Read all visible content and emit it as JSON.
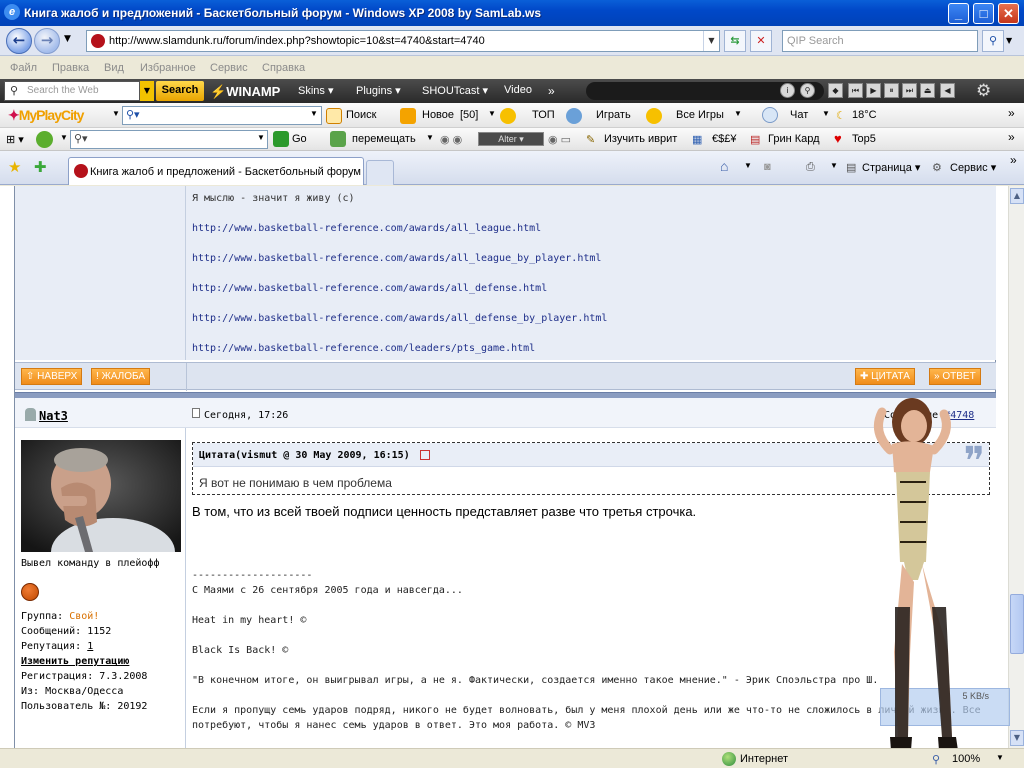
{
  "window": {
    "title": "Книга жалоб и предложений - Баскетбольный форум - Windows XP 2008 by SamLab.ws"
  },
  "address": {
    "url": "http://www.slamdunk.ru/forum/index.php?showtopic=10&st=4740&start=4740",
    "search_placeholder": "QIP Search"
  },
  "menu": [
    "Файл",
    "Правка",
    "Вид",
    "Избранное",
    "Сервис",
    "Справка"
  ],
  "winamp": {
    "search_placeholder": "Search the Web",
    "search_button": "Search",
    "logo": "WINAMP",
    "menus": [
      "Skins",
      "Plugins",
      "SHOUTcast",
      "Video"
    ]
  },
  "mailru": {
    "logo": "MyPlayCity",
    "search": "Поиск",
    "new": "Новое",
    "new_count": "[50]",
    "top": "ТОП",
    "play": "Играть",
    "all_games": "Все Игры",
    "chat": "Чат",
    "weather": "18°C"
  },
  "bar3": {
    "go": "Go",
    "move": "перемещать",
    "player": "Alter",
    "learn": "Изучить иврит",
    "currency": "€$£¥",
    "green_card": "Грин Кард",
    "top5": "Top5"
  },
  "tabs": {
    "active": "Книга жалоб и предложений - Баскетбольный форум",
    "page": "Страница",
    "tools": "Сервис"
  },
  "prev_post": {
    "sig_lines": [
      "Я мыслю - значит я живу (с)",
      "http://www.basketball-reference.com/awards/all_league.html",
      "http://www.basketball-reference.com/awards/all_league_by_player.html",
      "http://www.basketball-reference.com/awards/all_defense.html",
      "http://www.basketball-reference.com/awards/all_defense_by_player.html",
      "http://www.basketball-reference.com/leaders/pts_game.html"
    ],
    "btn_top": "НАВЕРХ",
    "btn_report": "ЖАЛОБА",
    "btn_quote": "ЦИТАТА",
    "btn_reply": "ОТВЕТ"
  },
  "post": {
    "username": "Nat3",
    "date": "Сегодня, 17:26",
    "msg_label": "Сообщение",
    "msg_no": "#4748",
    "quote_header": "Цитата(vismut @ 30 May 2009, 16:15)",
    "quote_text": "Я вот не понимаю в чем проблема",
    "body": "В том, что из всей твоей подписи ценность представляет разве что третья строчка.",
    "sig_lines": [
      "--------------------",
      "С Маями с 26 сентября 2005 года и навсегда...",
      "Heat in my heart! ©",
      "Black Is Back! ©",
      "\"В конечном итоге, он выигрывал игры, а не я. Фактически, создается именно такое мнение.\" - Эрик Споэльстра про Ш.",
      "Если я пропущу семь ударов подряд, никого не будет волновать, был у меня плохой день или же что-то не сложилось в личной жизни. Все",
      "потребуют, чтобы я нанес семь ударов в ответ. Это моя работа. © MV3"
    ]
  },
  "poster": {
    "status": "Вывел команду в плейофф",
    "group_label": "Группа:",
    "group": "Свой!",
    "posts": "Сообщений: 1152",
    "rep_label": "Репутация:",
    "rep": "1",
    "change_rep": "Изменить репутацию",
    "reg": "Регистрация: 7.3.2008",
    "from": "Из: Москва/Одесса",
    "user_no": "Пользователь №: 20192"
  },
  "overlay": {
    "speed": "5 KB/s"
  },
  "status": {
    "zone": "Интернет",
    "zoom": "100%"
  }
}
